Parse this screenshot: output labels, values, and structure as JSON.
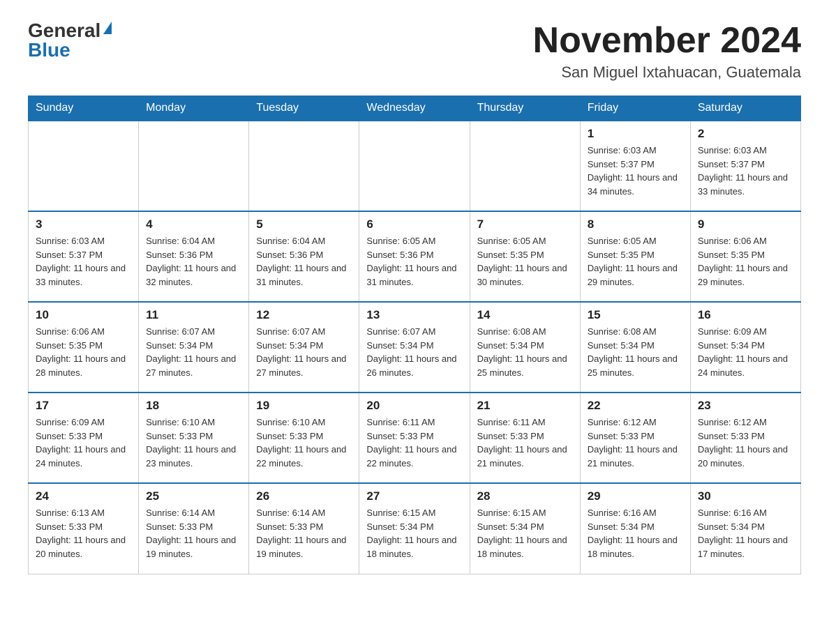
{
  "header": {
    "logo_general": "General",
    "logo_blue": "Blue",
    "month_title": "November 2024",
    "location": "San Miguel Ixtahuacan, Guatemala"
  },
  "days_of_week": [
    "Sunday",
    "Monday",
    "Tuesday",
    "Wednesday",
    "Thursday",
    "Friday",
    "Saturday"
  ],
  "weeks": [
    [
      {
        "day": "",
        "sunrise": "",
        "sunset": "",
        "daylight": ""
      },
      {
        "day": "",
        "sunrise": "",
        "sunset": "",
        "daylight": ""
      },
      {
        "day": "",
        "sunrise": "",
        "sunset": "",
        "daylight": ""
      },
      {
        "day": "",
        "sunrise": "",
        "sunset": "",
        "daylight": ""
      },
      {
        "day": "",
        "sunrise": "",
        "sunset": "",
        "daylight": ""
      },
      {
        "day": "1",
        "sunrise": "Sunrise: 6:03 AM",
        "sunset": "Sunset: 5:37 PM",
        "daylight": "Daylight: 11 hours and 34 minutes."
      },
      {
        "day": "2",
        "sunrise": "Sunrise: 6:03 AM",
        "sunset": "Sunset: 5:37 PM",
        "daylight": "Daylight: 11 hours and 33 minutes."
      }
    ],
    [
      {
        "day": "3",
        "sunrise": "Sunrise: 6:03 AM",
        "sunset": "Sunset: 5:37 PM",
        "daylight": "Daylight: 11 hours and 33 minutes."
      },
      {
        "day": "4",
        "sunrise": "Sunrise: 6:04 AM",
        "sunset": "Sunset: 5:36 PM",
        "daylight": "Daylight: 11 hours and 32 minutes."
      },
      {
        "day": "5",
        "sunrise": "Sunrise: 6:04 AM",
        "sunset": "Sunset: 5:36 PM",
        "daylight": "Daylight: 11 hours and 31 minutes."
      },
      {
        "day": "6",
        "sunrise": "Sunrise: 6:05 AM",
        "sunset": "Sunset: 5:36 PM",
        "daylight": "Daylight: 11 hours and 31 minutes."
      },
      {
        "day": "7",
        "sunrise": "Sunrise: 6:05 AM",
        "sunset": "Sunset: 5:35 PM",
        "daylight": "Daylight: 11 hours and 30 minutes."
      },
      {
        "day": "8",
        "sunrise": "Sunrise: 6:05 AM",
        "sunset": "Sunset: 5:35 PM",
        "daylight": "Daylight: 11 hours and 29 minutes."
      },
      {
        "day": "9",
        "sunrise": "Sunrise: 6:06 AM",
        "sunset": "Sunset: 5:35 PM",
        "daylight": "Daylight: 11 hours and 29 minutes."
      }
    ],
    [
      {
        "day": "10",
        "sunrise": "Sunrise: 6:06 AM",
        "sunset": "Sunset: 5:35 PM",
        "daylight": "Daylight: 11 hours and 28 minutes."
      },
      {
        "day": "11",
        "sunrise": "Sunrise: 6:07 AM",
        "sunset": "Sunset: 5:34 PM",
        "daylight": "Daylight: 11 hours and 27 minutes."
      },
      {
        "day": "12",
        "sunrise": "Sunrise: 6:07 AM",
        "sunset": "Sunset: 5:34 PM",
        "daylight": "Daylight: 11 hours and 27 minutes."
      },
      {
        "day": "13",
        "sunrise": "Sunrise: 6:07 AM",
        "sunset": "Sunset: 5:34 PM",
        "daylight": "Daylight: 11 hours and 26 minutes."
      },
      {
        "day": "14",
        "sunrise": "Sunrise: 6:08 AM",
        "sunset": "Sunset: 5:34 PM",
        "daylight": "Daylight: 11 hours and 25 minutes."
      },
      {
        "day": "15",
        "sunrise": "Sunrise: 6:08 AM",
        "sunset": "Sunset: 5:34 PM",
        "daylight": "Daylight: 11 hours and 25 minutes."
      },
      {
        "day": "16",
        "sunrise": "Sunrise: 6:09 AM",
        "sunset": "Sunset: 5:34 PM",
        "daylight": "Daylight: 11 hours and 24 minutes."
      }
    ],
    [
      {
        "day": "17",
        "sunrise": "Sunrise: 6:09 AM",
        "sunset": "Sunset: 5:33 PM",
        "daylight": "Daylight: 11 hours and 24 minutes."
      },
      {
        "day": "18",
        "sunrise": "Sunrise: 6:10 AM",
        "sunset": "Sunset: 5:33 PM",
        "daylight": "Daylight: 11 hours and 23 minutes."
      },
      {
        "day": "19",
        "sunrise": "Sunrise: 6:10 AM",
        "sunset": "Sunset: 5:33 PM",
        "daylight": "Daylight: 11 hours and 22 minutes."
      },
      {
        "day": "20",
        "sunrise": "Sunrise: 6:11 AM",
        "sunset": "Sunset: 5:33 PM",
        "daylight": "Daylight: 11 hours and 22 minutes."
      },
      {
        "day": "21",
        "sunrise": "Sunrise: 6:11 AM",
        "sunset": "Sunset: 5:33 PM",
        "daylight": "Daylight: 11 hours and 21 minutes."
      },
      {
        "day": "22",
        "sunrise": "Sunrise: 6:12 AM",
        "sunset": "Sunset: 5:33 PM",
        "daylight": "Daylight: 11 hours and 21 minutes."
      },
      {
        "day": "23",
        "sunrise": "Sunrise: 6:12 AM",
        "sunset": "Sunset: 5:33 PM",
        "daylight": "Daylight: 11 hours and 20 minutes."
      }
    ],
    [
      {
        "day": "24",
        "sunrise": "Sunrise: 6:13 AM",
        "sunset": "Sunset: 5:33 PM",
        "daylight": "Daylight: 11 hours and 20 minutes."
      },
      {
        "day": "25",
        "sunrise": "Sunrise: 6:14 AM",
        "sunset": "Sunset: 5:33 PM",
        "daylight": "Daylight: 11 hours and 19 minutes."
      },
      {
        "day": "26",
        "sunrise": "Sunrise: 6:14 AM",
        "sunset": "Sunset: 5:33 PM",
        "daylight": "Daylight: 11 hours and 19 minutes."
      },
      {
        "day": "27",
        "sunrise": "Sunrise: 6:15 AM",
        "sunset": "Sunset: 5:34 PM",
        "daylight": "Daylight: 11 hours and 18 minutes."
      },
      {
        "day": "28",
        "sunrise": "Sunrise: 6:15 AM",
        "sunset": "Sunset: 5:34 PM",
        "daylight": "Daylight: 11 hours and 18 minutes."
      },
      {
        "day": "29",
        "sunrise": "Sunrise: 6:16 AM",
        "sunset": "Sunset: 5:34 PM",
        "daylight": "Daylight: 11 hours and 18 minutes."
      },
      {
        "day": "30",
        "sunrise": "Sunrise: 6:16 AM",
        "sunset": "Sunset: 5:34 PM",
        "daylight": "Daylight: 11 hours and 17 minutes."
      }
    ]
  ]
}
